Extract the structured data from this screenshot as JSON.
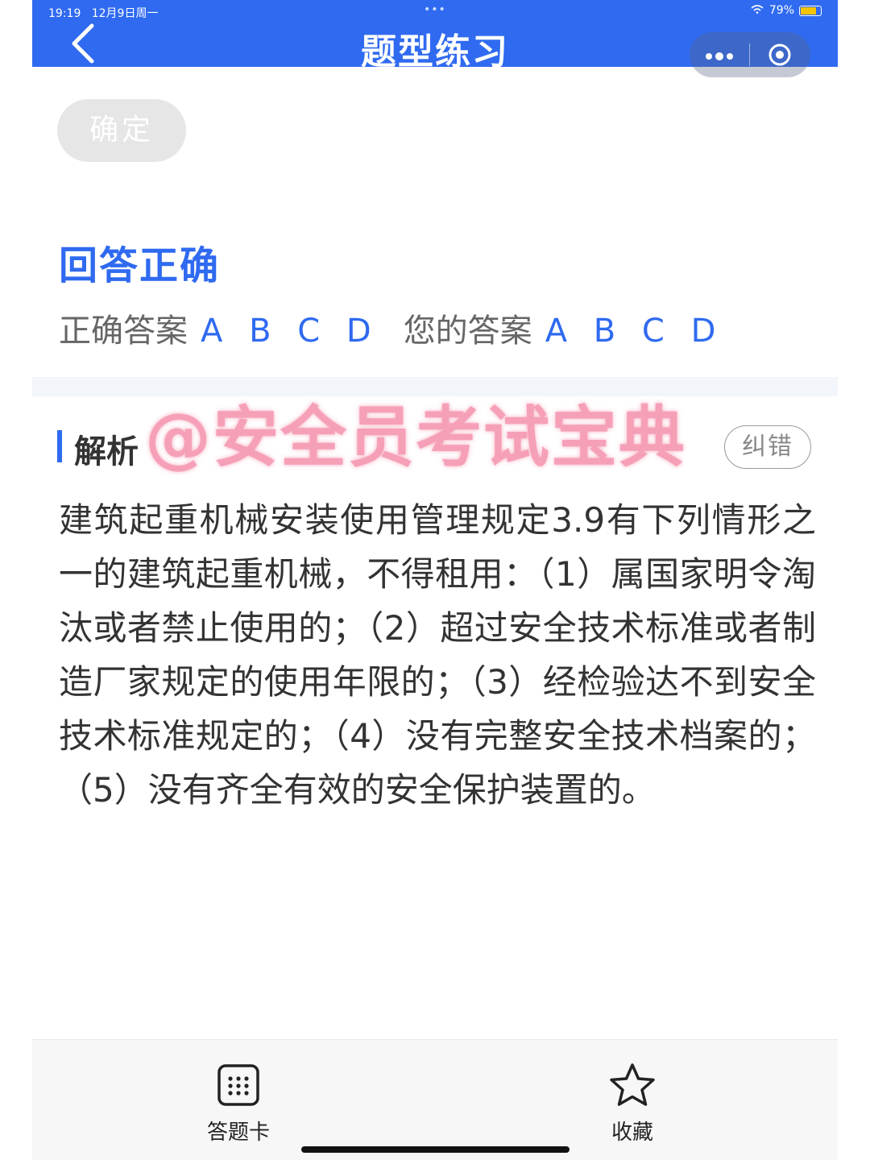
{
  "status_bar": {
    "time": "19:19",
    "date": "12月9日周一",
    "center_dots": "•••",
    "battery_percent": "79%",
    "battery_level": 0.79
  },
  "header": {
    "title": "题型练习",
    "more_icon": "ellipsis-icon",
    "close_icon": "target-icon",
    "back_icon": "chevron-left-icon"
  },
  "confirm_button": "确定",
  "result_text": "回答正确",
  "answers": {
    "correct_label": "正确答案",
    "correct_value": "A B C D",
    "yours_label": "您的答案",
    "yours_value": "A B C D"
  },
  "analysis": {
    "title": "解析",
    "report_button": "纠错",
    "text": "建筑起重机械安装使用管理规定3.9有下列情形之一的建筑起重机械，不得租用：（1）属国家明令淘汰或者禁止使用的；（2）超过安全技术标准或者制造厂家规定的使用年限的；（3）经检验达不到安全技术标准规定的；（4）没有完整安全技术档案的；（5）没有齐全有效的安全保护装置的。"
  },
  "watermark": "@安全员考试宝典",
  "bottom_bar": {
    "answer_card_label": "答题卡",
    "favorite_label": "收藏"
  },
  "colors": {
    "accent": "#2f6af0",
    "watermark": "#f6a0b8"
  }
}
